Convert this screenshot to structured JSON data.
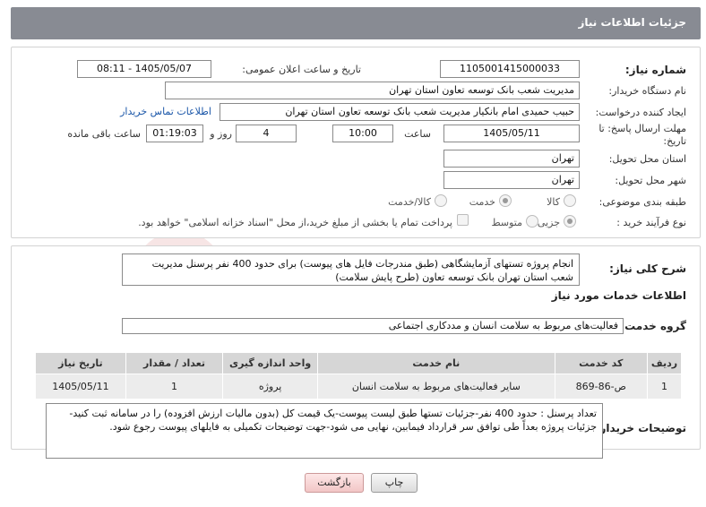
{
  "header": {
    "title": "جزئیات اطلاعات نیاز"
  },
  "form": {
    "need_number_label": "شماره نیاز:",
    "need_number": "1105001415000033",
    "announce_label": "تاریخ و ساعت اعلان عمومی:",
    "announce_value": "1405/05/07 - 08:11",
    "buyer_org_label": "نام دستگاه خریدار:",
    "buyer_org": "مدیریت شعب بانک توسعه تعاون استان تهران",
    "creator_label": "ایجاد کننده درخواست:",
    "creator": "حبیب حمیدی امام بانکیار مدیریت شعب بانک توسعه تعاون استان تهران",
    "contact_link": "اطلاعات تماس خریدار",
    "deadline_label_1": "مهلت ارسال پاسخ: تا",
    "deadline_label_2": "تاریخ:",
    "deadline_date": "1405/05/11",
    "time_label": "ساعت",
    "deadline_time": "10:00",
    "days_value": "4",
    "days_label": "روز و",
    "remaining_value": "01:19:03",
    "remaining_label": "ساعت باقی مانده",
    "province_label": "استان محل تحویل:",
    "province": "تهران",
    "city_label": "شهر محل تحویل:",
    "city": "تهران",
    "category_label": "طبقه بندی موضوعی:",
    "category_options": [
      "کالا",
      "خدمت",
      "کالا/خدمت"
    ],
    "category_selected": "خدمت",
    "purchase_label": "نوع فرآیند خرید :",
    "purchase_options": [
      "جزیی",
      "متوسط"
    ],
    "purchase_selected": "جزیی",
    "purchase_note": "پرداخت تمام یا بخشی از مبلغ خرید،از محل \"اسناد خزانه اسلامی\" خواهد بود."
  },
  "summary": {
    "label": "شرح کلی نیاز:",
    "text": "انجام پروژه تستهای آزمایشگاهی (طبق مندرجات فایل های پیوست) برای حدود 400 نفر پرسنل مدیریت شعب استان تهران بانک توسعه تعاون (طرح پایش سلامت)"
  },
  "services": {
    "section_title": "اطلاعات خدمات مورد نیاز",
    "group_label": "گروه خدمت:",
    "group_value": "فعالیت‌های مربوط به سلامت انسان و مددکاری اجتماعی",
    "columns": [
      "ردیف",
      "کد خدمت",
      "نام خدمت",
      "واحد اندازه گیری",
      "تعداد / مقدار",
      "تاریخ نیاز"
    ],
    "rows": [
      [
        "1",
        "ص-86-869",
        "سایر فعالیت‌های مربوط به سلامت انسان",
        "پروژه",
        "1",
        "1405/05/11"
      ]
    ]
  },
  "buyer_notes": {
    "label": "توضیحات خریدار:",
    "text": "تعداد پرسنل : حدود 400 نفر-جزئیات تستها طبق لیست پیوست-یک قیمت کل (بدون مالیات ارزش افزوده) را در سامانه ثبت کنید-جزئیات پروژه بعداً طی توافق سر قرارداد فیمابین، نهایی می شود-جهت توضیحات تکمیلی به فایلهای پیوست رجوع شود."
  },
  "buttons": {
    "print": "چاپ",
    "back": "بازگشت"
  },
  "watermark": {
    "text": "AriaTender.net"
  },
  "colors": {
    "title_bar": "#888b93",
    "link": "#1a56a8",
    "back_button": "#f2c6c6"
  }
}
